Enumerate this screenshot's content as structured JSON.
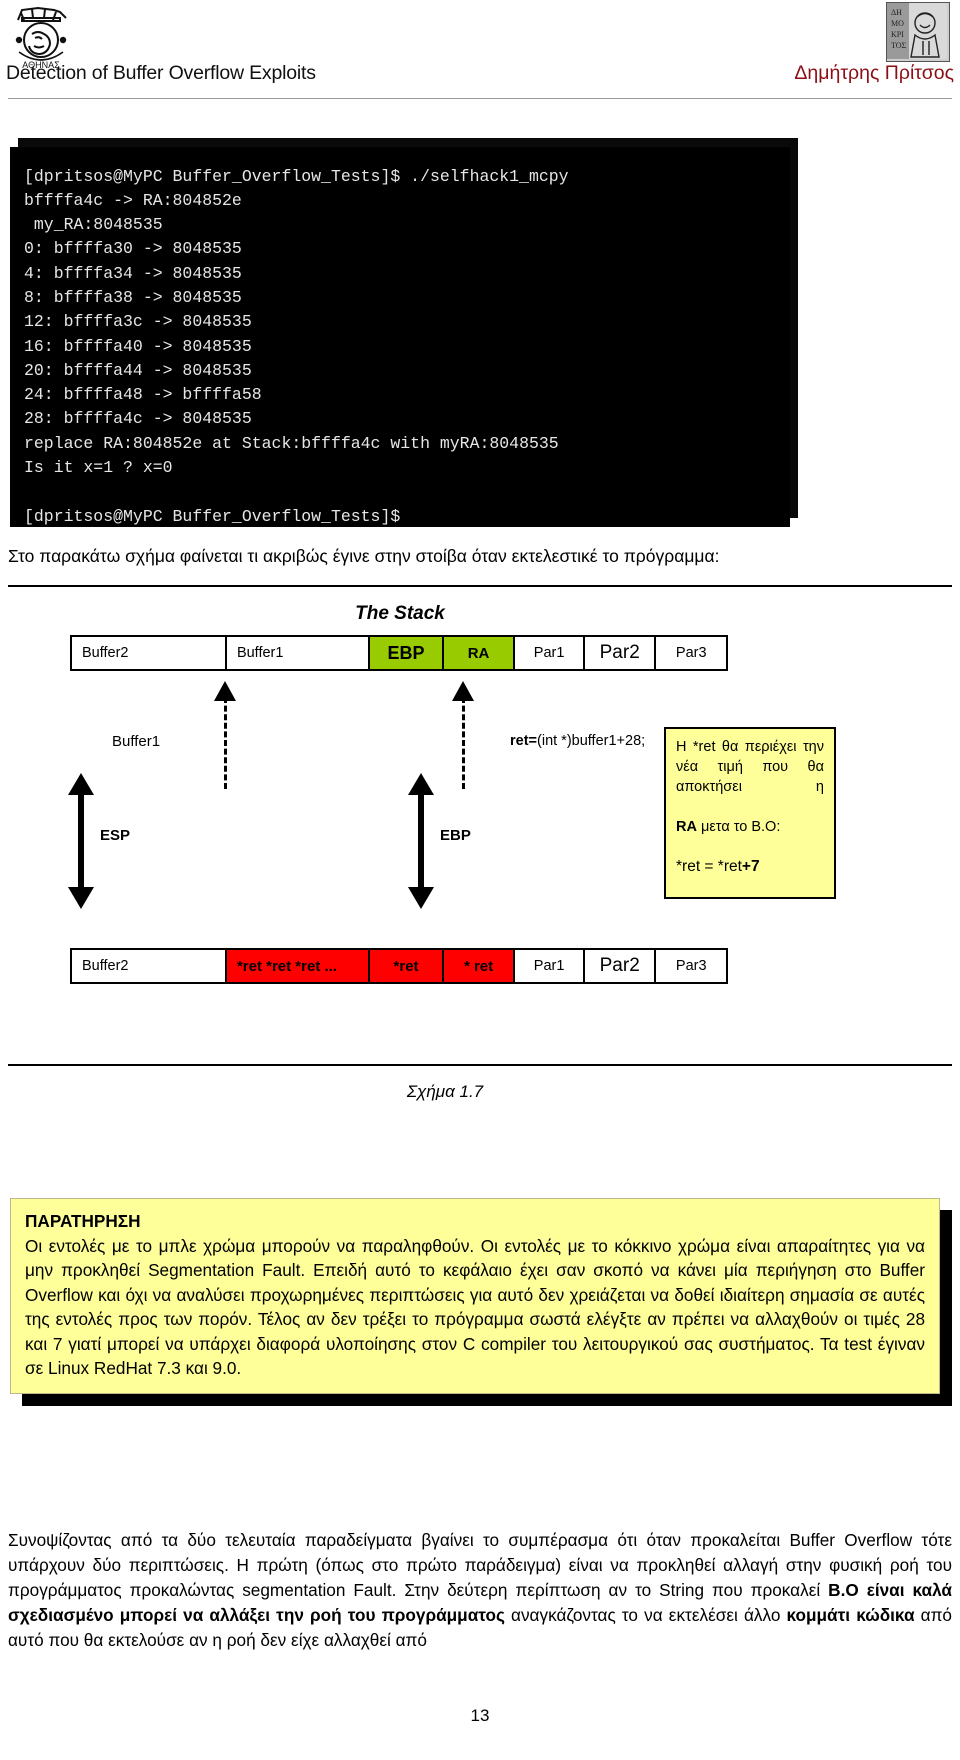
{
  "header": {
    "title": "Detection of Buffer Overflow Exploits",
    "author": "Δημήτρης Πρίτσος",
    "author_color": "#8d0f16",
    "logo_left_name": "tei-athens-logo",
    "logo_right_name": "author-portrait"
  },
  "terminal": {
    "text": "[dpritsos@MyPC Buffer_Overflow_Tests]$ ./selfhack1_mcpy\nbffffa4c -> RA:804852e\n my_RA:8048535\n0: bffffa30 -> 8048535\n4: bffffa34 -> 8048535\n8: bffffa38 -> 8048535\n12: bffffa3c -> 8048535\n16: bffffa40 -> 8048535\n20: bffffa44 -> 8048535\n24: bffffa48 -> bffffa58\n28: bffffa4c -> 8048535\nreplace RA:804852e at Stack:bffffa4c with myRA:8048535\nIs it x=1 ? x=0\n\n[dpritsos@MyPC Buffer_Overflow_Tests]$"
  },
  "intro_line": "Στο παρακάτω σχήμα φαίνεται τι ακριβώς έγινε στην στοίβα όταν εκτελεστικέ το πρόγραμμα:",
  "figure": {
    "stack_title": "The Stack",
    "caption": "Σχήμα 1.7",
    "top_row": [
      {
        "label": "Buffer2",
        "style": "plain"
      },
      {
        "label": "Buffer1",
        "style": "plain"
      },
      {
        "label": "EBP",
        "style": "green-bold"
      },
      {
        "label": "RA",
        "style": "green-semi"
      },
      {
        "label": "Par1",
        "style": "plain"
      },
      {
        "label": "Par2",
        "style": "big"
      },
      {
        "label": "Par3",
        "style": "plain"
      }
    ],
    "bottom_row": [
      {
        "label": "Buffer2",
        "style": "plain"
      },
      {
        "label": "*ret *ret *ret ...",
        "style": "red-semi"
      },
      {
        "label": "*ret",
        "style": "red-semi"
      },
      {
        "label": "* ret",
        "style": "red-semi"
      },
      {
        "label": "Par1",
        "style": "plain"
      },
      {
        "label": "Par2",
        "style": "big"
      },
      {
        "label": "Par3",
        "style": "plain"
      }
    ],
    "label_buffer1": "Buffer1",
    "label_esp": "ESP",
    "label_ebp": "EBP",
    "ret_expression_bold": "ret=",
    "ret_expression_rest": "(int *)buffer1+28;",
    "callout": {
      "body": "Η *ret θα περιέχει την νέα τιμή που θα αποκτήσει η ",
      "body_bold": "RA",
      "body_tail": " μετα το B.O:",
      "formula_plain": "*ret = *ret",
      "formula_bold": "+7"
    },
    "colors": {
      "green_cell": "#99cc00",
      "red_cell": "#fe0000",
      "callout_bg": "#ffff99"
    }
  },
  "note": {
    "title": "ΠΑΡΑΤΗΡΗΣΗ",
    "p1": "Οι εντολές με το μπλε χρώμα μπορούν να παραληφθούν. Οι εντολές με το κόκκινο χρώμα είναι απαραίτητες για να μην προκληθεί Segmentation Fault. Επειδή αυτό το κεφάλαιο έχει σαν σκοπό να κάνει μία περιήγηση στο Buffer Overflow και όχι να αναλύσει προχωρημένες περιπτώσεις για αυτό δεν χρειάζεται να δοθεί ιδιαίτερη σημασία σε αυτές της εντολές προς των πορόν. Τέλος αν δεν τρέξει το πρόγραμμα σωστά ελέγξτε αν πρέπει να αλλαχθούν οι τιμές 28 και 7 γιατί μπορεί να υπάρχει διαφορά υλοποίησης στον C compiler του λειτουργικού σας συστήματος. Τα test έγιναν σε Linux RedHat 7.3 και 9.0.",
    "bg_color": "#ffff99"
  },
  "closing": {
    "part1": "Συνοψίζοντας από τα δύο τελευταία παραδείγματα βγαίνει το συμπέρασμα ότι όταν προκαλείται Buffer Overflow τότε υπάρχουν δύο περιπτώσεις. Η πρώτη (όπως στο πρώτο παράδειγμα) είναι να προκληθεί αλλαγή στην φυσική ροή του προγράμματος προκαλώντας segmentation Fault. Στην δεύτερη περίπτωση αν το String που προκαλεί ",
    "bold1": "B.O είναι καλά σχεδιασμένο μπορεί να αλλάξει την ροή του προγράμματος ",
    "part2": "αναγκάζοντας το να εκτελέσει άλλο ",
    "bold2": "κομμάτι κώδικα ",
    "part3": "από αυτό που θα εκτελούσε αν η ροή δεν είχε αλλαχθεί από"
  },
  "page_number": "13"
}
